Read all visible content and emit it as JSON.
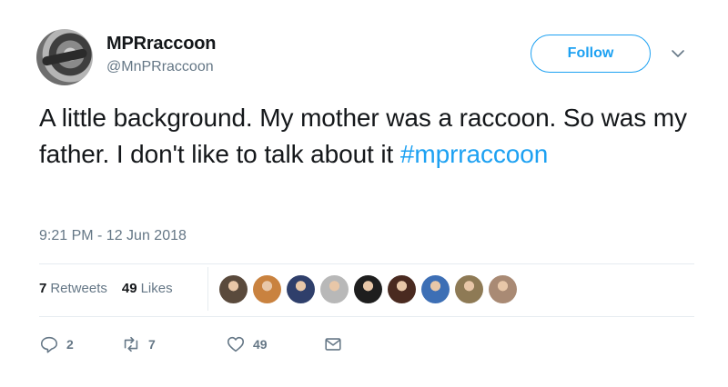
{
  "user": {
    "display_name": "MPRraccoon",
    "handle": "@MnPRraccoon",
    "avatar_icon": "raccoon-avatar"
  },
  "follow_label": "Follow",
  "tweet": {
    "text": "A little background. My mother was a raccoon. So was my father. I don't like to talk about it",
    "hashtag": "#mprraccoon",
    "timestamp": "9:21 PM - 12 Jun 2018"
  },
  "stats": {
    "retweets_count": "7",
    "retweets_label": "Retweets",
    "likes_count": "49",
    "likes_label": "Likes"
  },
  "liker_avatars": [
    {
      "name": "liker-avatar-1",
      "color": "#5a4a3c"
    },
    {
      "name": "liker-avatar-2",
      "color": "#c9823f"
    },
    {
      "name": "liker-avatar-3",
      "color": "#2f3f6b"
    },
    {
      "name": "liker-avatar-4",
      "color": "#b8b8b8"
    },
    {
      "name": "liker-avatar-5",
      "color": "#1e1e1e"
    },
    {
      "name": "liker-avatar-6",
      "color": "#4a2a20"
    },
    {
      "name": "liker-avatar-7",
      "color": "#3d6fb5"
    },
    {
      "name": "liker-avatar-8",
      "color": "#8e7a55"
    },
    {
      "name": "liker-avatar-9",
      "color": "#a98a74"
    }
  ],
  "actions": {
    "reply_count": "2",
    "retweet_count": "7",
    "like_count": "49"
  },
  "colors": {
    "accent": "#1da1f2",
    "text": "#14171a",
    "secondary": "#657786",
    "divider": "#e6ecf0"
  }
}
